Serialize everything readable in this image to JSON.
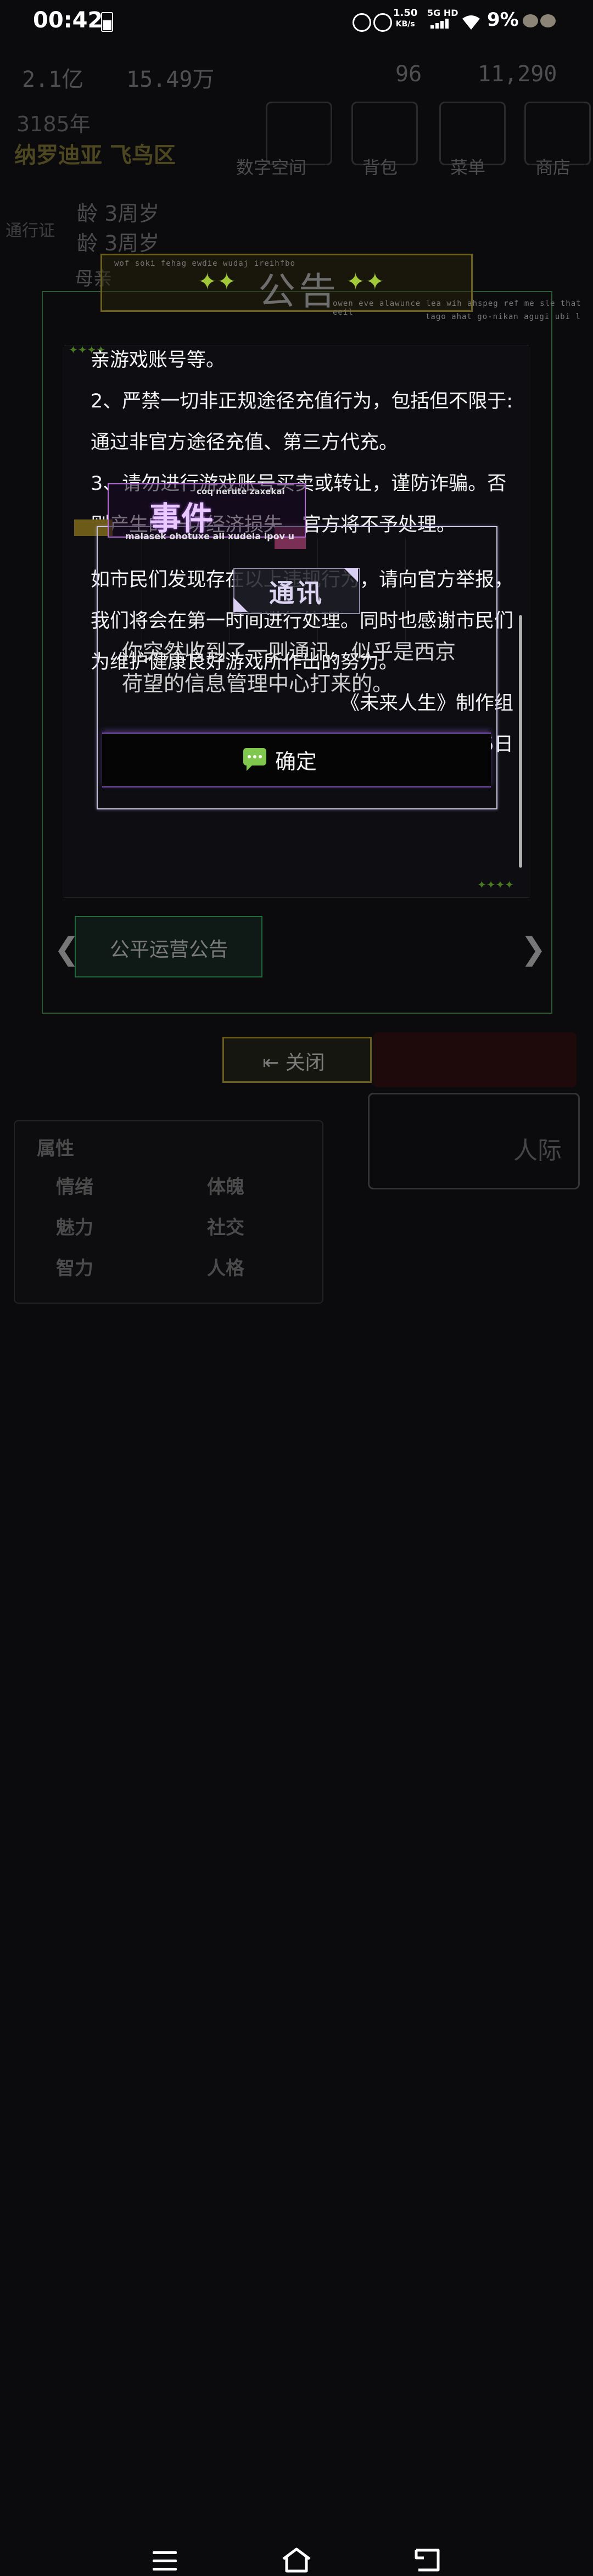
{
  "status_bar": {
    "time": "00:42",
    "net_speed_value": "1.50",
    "net_speed_unit": "KB/s",
    "net_type": "5G HD",
    "battery_pct": "9%"
  },
  "background": {
    "res_a": "2.1亿",
    "res_b": "15.49万",
    "res_c": "96",
    "res_d": "11,290",
    "year": "3185年",
    "location": "纳罗迪亚 飞鸟区",
    "tile_labels": [
      "数字空间",
      "背包",
      "菜单",
      "商店"
    ],
    "age_1": "龄 3周岁",
    "age_2": "龄 3周岁",
    "pass": "通行证",
    "mother": "母亲",
    "stats_title": "属性",
    "stats": [
      "情绪",
      "魅力",
      "智力",
      "体魄",
      "社交",
      "人格"
    ],
    "social": "人际"
  },
  "announcement": {
    "title": "公告",
    "deco_text_1": "wof soki fehag ewdie wudaj ireihfbo",
    "deco_text_2": "owen eve alawunce lea wih ahspeg ref me sle that eeil",
    "deco_text_3": "tago ahat go-nikan agugi ubi l",
    "lines": [
      "亲游戏账号等。",
      "2、严禁一切非正规途径充值行为，包括但不限于: 通过非官方途径充值、第三方代充。",
      "3、请勿进行游戏账号买卖或转让，谨防诈骗。否则产生的一切经济损失，官方将不予处理。",
      "如市民们发现存在以上违规行为，请向官方举报，我们将会在第一时间进行处理。同时也感谢市民们为维护健康良好游戏所作出的努力。"
    ],
    "signature": "《未来人生》制作组",
    "date": "2024年8月25日",
    "tab_label": "公平运营公告",
    "close_label": "关闭"
  },
  "event_dialog": {
    "title": "事件",
    "subtitle_top": "coq nerute zaxekai",
    "subtitle": "malasek ohotuxe ali xudela ipov u",
    "type_label": "通讯",
    "message": "你突然收到了一则通讯，似乎是西京荷望的信息管理中心打来的。",
    "confirm_label": "确定"
  },
  "colors": {
    "event_accent": "#b56bd6",
    "announcement_border": "#2c5a32",
    "star_accent": "#a2c93a",
    "chat_icon": "#7fc84d"
  }
}
